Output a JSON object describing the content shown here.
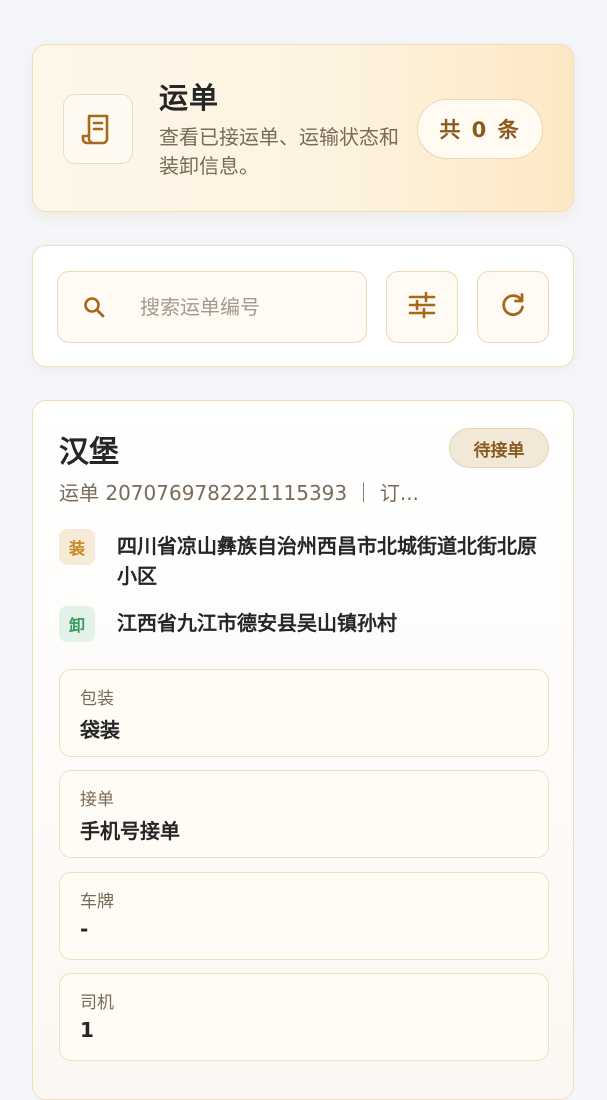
{
  "header": {
    "title": "运单",
    "description": "查看已接运单、运输状态和装卸信息。",
    "count_label": "共 0 条",
    "icon": "receipt-icon"
  },
  "search": {
    "placeholder": "搜索运单编号",
    "value": "",
    "search_icon": "search-icon",
    "filter_icon": "sliders-icon",
    "refresh_icon": "refresh-icon"
  },
  "order": {
    "title": "汉堡",
    "status": "待接单",
    "subtitle": "运单 2070769782221115393 ｜ 订...",
    "load_tag": "装",
    "load_address": "四川省凉山彝族自治州西昌市北城街道北街北原小区",
    "unload_tag": "卸",
    "unload_address": "江西省九江市德安县吴山镇孙村",
    "fields": [
      {
        "label": "包装",
        "value": "袋装"
      },
      {
        "label": "接单",
        "value": "手机号接单"
      },
      {
        "label": "车牌",
        "value": "-"
      },
      {
        "label": "司机",
        "value": "1"
      }
    ]
  },
  "colors": {
    "accent": "#8b5a1f",
    "load_tag": "#c8851f",
    "unload_tag": "#3a9a60",
    "border": "#f0dcb6"
  }
}
